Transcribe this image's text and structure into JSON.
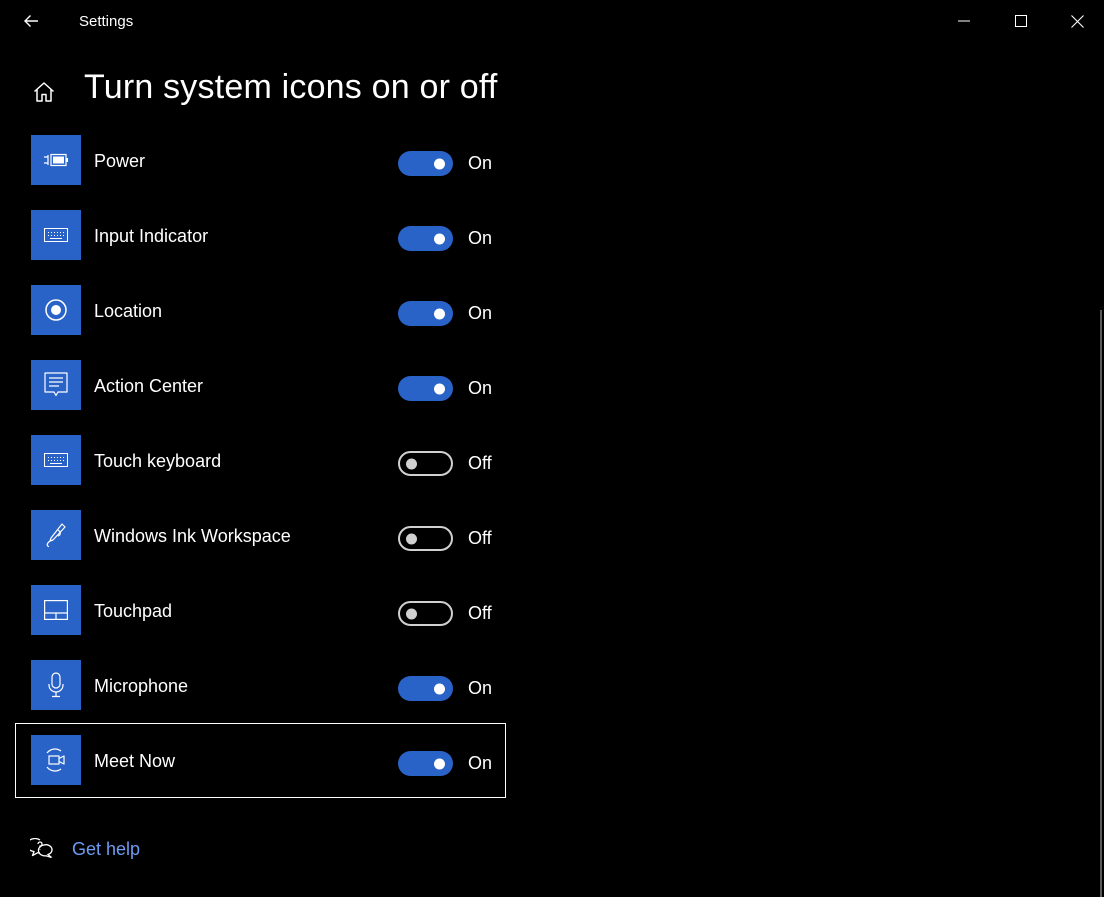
{
  "window": {
    "title": "Settings",
    "back_icon": "back-arrow-icon",
    "controls": {
      "minimize": "minimize-icon",
      "maximize": "maximize-icon",
      "close": "close-icon"
    }
  },
  "header": {
    "home_icon": "home-icon",
    "title": "Turn system icons on or off"
  },
  "colors": {
    "background": "#000000",
    "accent": "#2a63c7",
    "link": "#6d9cf2",
    "toggle_off": "#d0d0d0"
  },
  "items": [
    {
      "label": "Power",
      "icon": "battery-plug-icon",
      "state": "On",
      "on": true
    },
    {
      "label": "Input Indicator",
      "icon": "keyboard-icon",
      "state": "On",
      "on": true
    },
    {
      "label": "Location",
      "icon": "location-icon",
      "state": "On",
      "on": true
    },
    {
      "label": "Action Center",
      "icon": "action-center-icon",
      "state": "On",
      "on": true
    },
    {
      "label": "Touch keyboard",
      "icon": "keyboard-icon",
      "state": "Off",
      "on": false
    },
    {
      "label": "Windows Ink Workspace",
      "icon": "pen-icon",
      "state": "Off",
      "on": false
    },
    {
      "label": "Touchpad",
      "icon": "touchpad-icon",
      "state": "Off",
      "on": false
    },
    {
      "label": "Microphone",
      "icon": "microphone-icon",
      "state": "On",
      "on": true
    },
    {
      "label": "Meet Now",
      "icon": "meet-now-icon",
      "state": "On",
      "on": true,
      "focused": true
    }
  ],
  "help": {
    "icon": "help-chat-icon",
    "label": "Get help"
  }
}
